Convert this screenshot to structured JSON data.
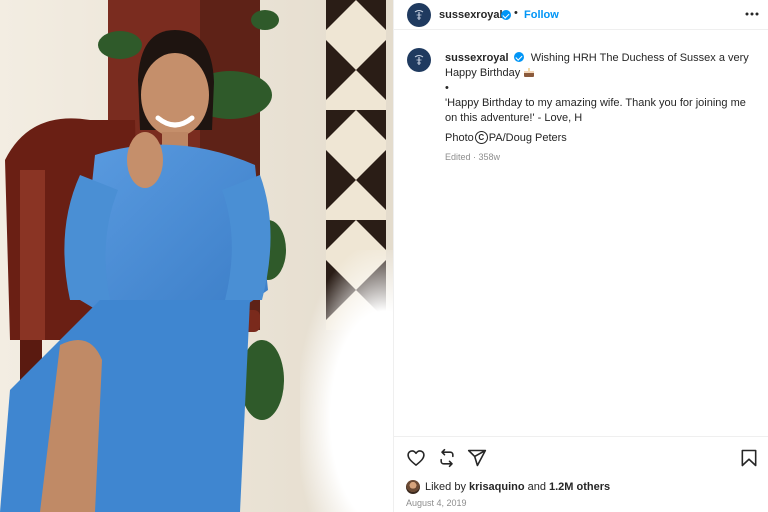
{
  "header": {
    "username": "sussexroyal",
    "separator": "•",
    "follow_label": "Follow",
    "more_icon": "more-horizontal-icon"
  },
  "caption": {
    "username": "sussexroyal",
    "line1": "Wishing HRH The Duchess of Sussex a very Happy Birthday",
    "bullet": "•",
    "quote": "'Happy Birthday to my amazing wife. Thank you for joining me on this adventure!' - Love, H",
    "credit_prefix": "Photo",
    "credit_symbol": "C",
    "credit_name": "PA/Doug Peters",
    "edited": "Edited · 358w"
  },
  "actions": {
    "like_icon": "heart-icon",
    "repost_icon": "repost-icon",
    "share_icon": "share-icon",
    "save_icon": "bookmark-icon"
  },
  "likes": {
    "prefix": "Liked by",
    "user": "krisaquino",
    "joiner": "and",
    "others": "1.2M others"
  },
  "date": "August 4, 2019",
  "colors": {
    "accent": "#0095f6",
    "avatar_bg": "#1f3a5f",
    "dress": "#4a8fd4",
    "muted_text": "#8e8e8e"
  }
}
